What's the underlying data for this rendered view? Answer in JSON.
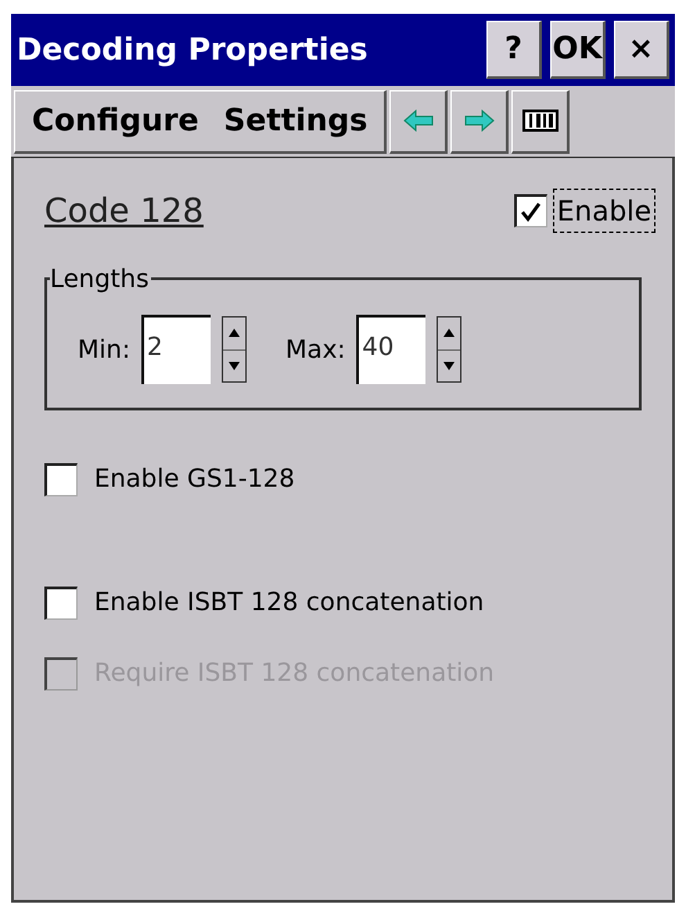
{
  "window": {
    "title": "Decoding Properties",
    "buttons": [
      "?",
      "OK",
      "×"
    ]
  },
  "menu": {
    "items": [
      "Configure",
      "Settings"
    ]
  },
  "symbology": {
    "name": "Code 128",
    "enable": {
      "label": "Enable",
      "checked": true,
      "focused": true
    }
  },
  "lengths": {
    "title": "Lengths",
    "fields": [
      {
        "label": "Min:",
        "value": "2"
      },
      {
        "label": "Max:",
        "value": "40"
      }
    ]
  },
  "options": [
    {
      "label": "Enable GS1-128",
      "checked": false,
      "disabled": false
    },
    {
      "label": "Enable ISBT 128 concatenation",
      "checked": false,
      "disabled": false
    },
    {
      "label": "Require ISBT 128 concatenation",
      "checked": false,
      "disabled": true
    }
  ]
}
